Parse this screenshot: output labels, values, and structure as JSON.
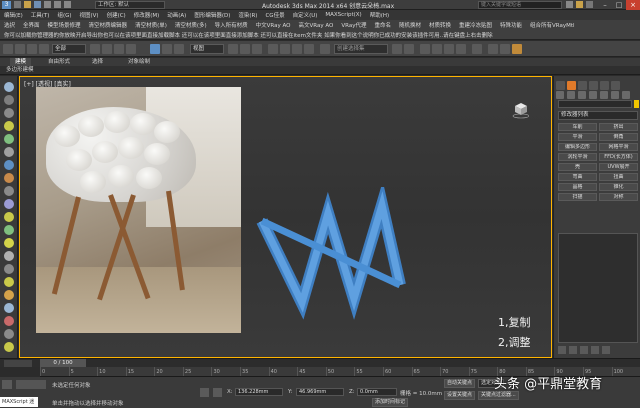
{
  "titlebar": {
    "workspace": "工作区: 默认",
    "title": "Autodesk 3ds Max  2014 x64      创意云朵椅.max",
    "search_placeholder": "键入关键字或短语"
  },
  "menubar": [
    "编辑(E)",
    "工具(T)",
    "组(G)",
    "视图(V)",
    "创建(C)",
    "修改器(M)",
    "动画(A)",
    "图形编辑器(D)",
    "渲染(R)",
    "CG佳景",
    "自定义(U)",
    "MAXScript(X)",
    "帮助(H)"
  ],
  "plugin_row1": [
    "选択",
    "全界面",
    "模型场景修理",
    "清空材质编辑器",
    "清空材质(单)",
    "清空材质(多)",
    "导入所有材质",
    "中文VRay AO",
    "高文VRay AO",
    "VRay代理",
    "重命名",
    "随机换材",
    "材质转换",
    "重建冷冻贴图",
    "特殊功能",
    "组合所有VRayMtl"
  ],
  "plugin_row2": "你可以加载你管理器的你放映开启导出你也可以在该项里面直接加载脚本  还可以在该项里面直接添加脚本  还可以直接在item文件夹  如果你看到这个说明你已成功的安装该插件可用..请在键盘上右击删除",
  "toolbar": {
    "filter": "全部",
    "view": "视图",
    "selection_set": "创建选择集"
  },
  "ribbon": {
    "tabs": [
      "建模",
      "自由形式",
      "选择",
      "对象绘制"
    ],
    "sub": "多边形建模"
  },
  "viewport": {
    "label": "[+] [透视] [真实]",
    "notes": [
      "1,复制",
      "2,调整"
    ]
  },
  "command_panel": {
    "modifier_list": "修改器列表",
    "buttons": [
      "车削",
      "挤出",
      "平滑",
      "倒角",
      "编辑多边形",
      "网格平滑",
      "涡轮平滑",
      "FFD(长方体)",
      "壳",
      "UVW展开",
      "弯曲",
      "扭曲",
      "晶格",
      "锥化",
      "扫描",
      "对称"
    ]
  },
  "timeline": {
    "frame": "0 / 100",
    "ticks": [
      "0",
      "5",
      "10",
      "15",
      "20",
      "25",
      "30",
      "35",
      "40",
      "45",
      "50",
      "55",
      "60",
      "65",
      "70",
      "75",
      "80",
      "85",
      "90",
      "95",
      "100"
    ]
  },
  "status": {
    "maxscript": "MAXScript 迷",
    "selection": "未选定任何对象",
    "prompt": "单击并拖动以选择并移动对象",
    "x_label": "X:",
    "x": "136.228mm",
    "y_label": "Y:",
    "y": "46.969mm",
    "z_label": "Z:",
    "z": "0.0mm",
    "grid": "栅格 = 10.0mm",
    "autokey": "自动关键点",
    "selected": "选定对象",
    "setkey": "设置关键点",
    "keyfilter": "关键点过滤器...",
    "add_time_tag": "添加时间标记"
  },
  "watermark": "头条 @平鼎堂教育"
}
